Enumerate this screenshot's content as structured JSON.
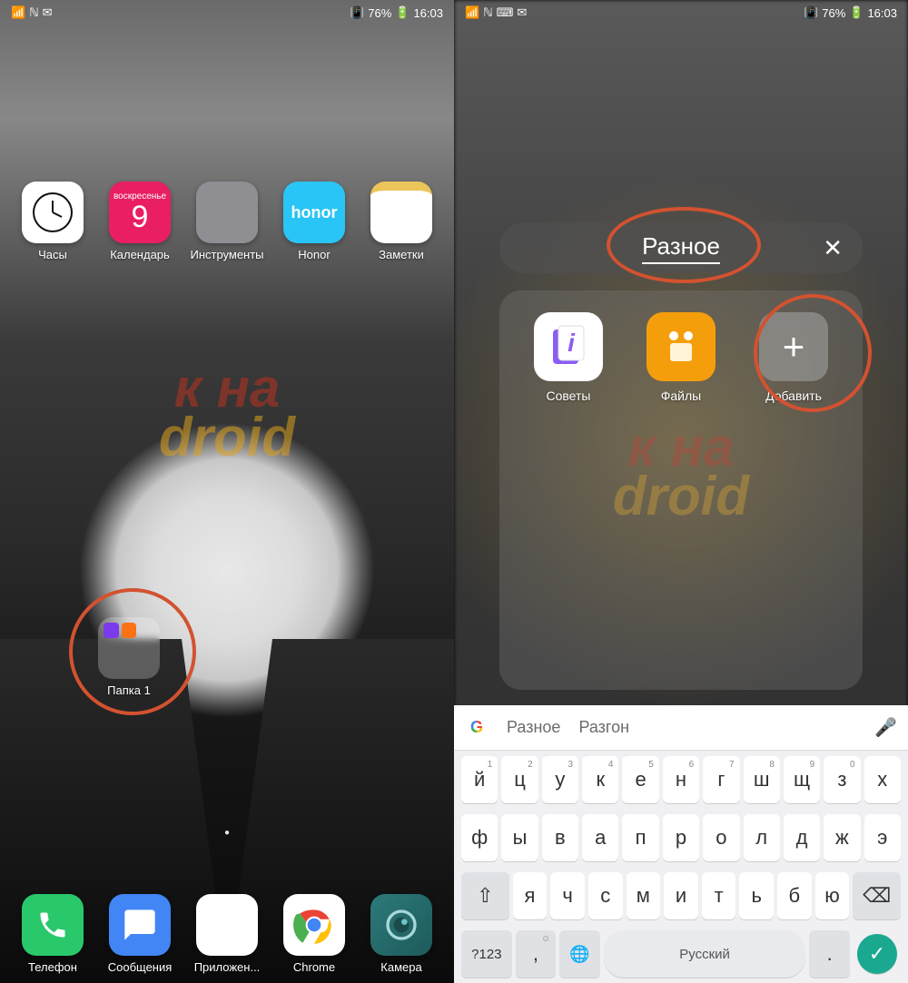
{
  "status": {
    "battery": "76%",
    "time": "16:03",
    "vibrate_icon": "📳",
    "nfc_icon": "ℕ"
  },
  "left": {
    "apps": [
      {
        "label": "Часы"
      },
      {
        "label": "Календарь",
        "cal_top": "воскресенье",
        "cal_day": "9"
      },
      {
        "label": "Инструменты"
      },
      {
        "label": "Honor",
        "brand": "honor"
      },
      {
        "label": "Заметки"
      }
    ],
    "folder": {
      "label": "Папка 1"
    },
    "dock": [
      {
        "label": "Телефон"
      },
      {
        "label": "Сообщения"
      },
      {
        "label": "Приложен..."
      },
      {
        "label": "Chrome"
      },
      {
        "label": "Камера"
      }
    ]
  },
  "right": {
    "folder_title": "Разное",
    "close": "✕",
    "items": [
      {
        "label": "Советы"
      },
      {
        "label": "Файлы"
      },
      {
        "label": "Добавить",
        "glyph": "+"
      }
    ],
    "keyboard": {
      "suggestions": [
        "Разное",
        "Разгон"
      ],
      "row1": [
        "й",
        "ц",
        "у",
        "к",
        "е",
        "н",
        "г",
        "ш",
        "щ",
        "з",
        "х"
      ],
      "row1_nums": [
        "1",
        "2",
        "3",
        "4",
        "5",
        "6",
        "7",
        "8",
        "9",
        "0",
        ""
      ],
      "row2": [
        "ф",
        "ы",
        "в",
        "а",
        "п",
        "р",
        "о",
        "л",
        "д",
        "ж",
        "э"
      ],
      "row3": [
        "я",
        "ч",
        "с",
        "м",
        "и",
        "т",
        "ь",
        "б",
        "ю"
      ],
      "shift": "⇧",
      "backspace": "⌫",
      "numkey": "?123",
      "comma": ",",
      "globe": "🌐",
      "space_label": "Русский",
      "period": ".",
      "enter": "✓",
      "emoji": "☺"
    }
  },
  "watermark": {
    "line1": "к на",
    "line2": "droid"
  }
}
